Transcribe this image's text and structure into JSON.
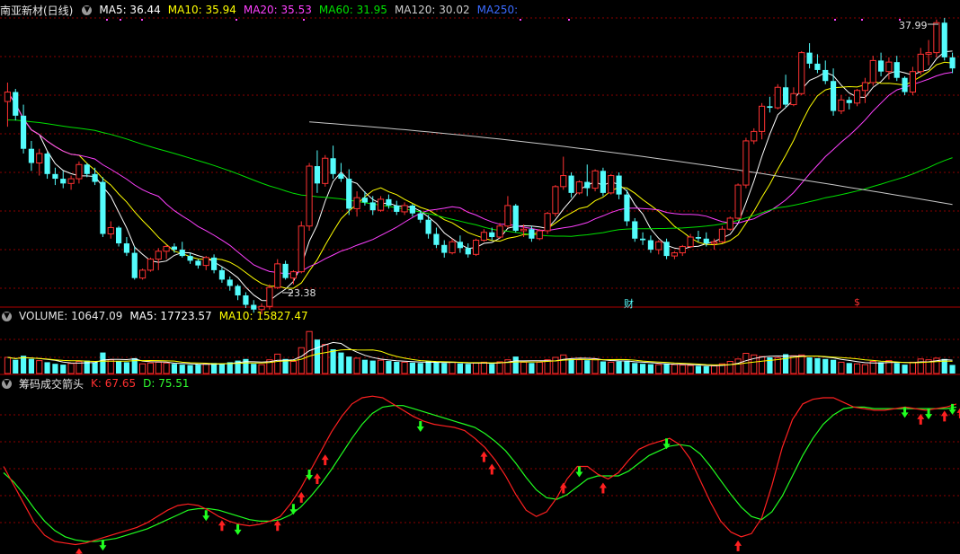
{
  "header_main": {
    "title": "南亚新材(日线)",
    "ma": [
      {
        "label": "MA5: 36.44",
        "color": "#ffffff"
      },
      {
        "label": "MA10: 35.94",
        "color": "#ffff00"
      },
      {
        "label": "MA20: 35.53",
        "color": "#ff40ff"
      },
      {
        "label": "MA60: 31.95",
        "color": "#00e000"
      },
      {
        "label": "MA120: 30.02",
        "color": "#cccccc"
      },
      {
        "label": "MA250:",
        "color": "#3b6bff"
      }
    ]
  },
  "header_volume": {
    "title": "VOLUME: 10647.09",
    "ma": [
      {
        "label": "MA5: 17723.57",
        "color": "#ffffff"
      },
      {
        "label": "MA10: 15827.47",
        "color": "#ffff00"
      }
    ]
  },
  "header_indicator": {
    "title": "筹码成交箭头",
    "k_label": "K: 67.65",
    "d_label": "D: 75.51",
    "k_color": "#ff3030",
    "d_color": "#30ff30"
  },
  "annotations": {
    "high_label": "37.99",
    "low_label": "23.38",
    "cai_tag": "财",
    "s_tag": "$"
  },
  "colors": {
    "up": "#ff3232",
    "down": "#54fcfc",
    "grid": "#8b0000",
    "ma5": "#ffffff",
    "ma10": "#ffff00",
    "ma20": "#ff40ff",
    "ma60": "#00e000",
    "ma120": "#c8c8c8",
    "k_line": "#ff2020",
    "d_line": "#20ff20"
  },
  "chart_data": {
    "type": "candlestick",
    "price_range": [
      21.5,
      39.5
    ],
    "volume_range": [
      0,
      60000
    ],
    "kd_range": [
      0,
      100
    ],
    "candles": [
      [
        34.2,
        35.4,
        32.6,
        34.8
      ],
      [
        34.8,
        35.0,
        33.0,
        33.3
      ],
      [
        33.3,
        34.0,
        30.9,
        31.2
      ],
      [
        31.2,
        31.7,
        29.8,
        30.3
      ],
      [
        30.3,
        31.2,
        29.5,
        30.9
      ],
      [
        30.9,
        31.0,
        29.3,
        29.6
      ],
      [
        29.6,
        30.0,
        28.9,
        29.3
      ],
      [
        29.3,
        29.8,
        28.7,
        29.0
      ],
      [
        29.0,
        29.5,
        28.6,
        29.3
      ],
      [
        29.3,
        30.4,
        29.0,
        30.2
      ],
      [
        30.2,
        30.3,
        29.4,
        29.6
      ],
      [
        29.6,
        30.0,
        28.9,
        29.1
      ],
      [
        29.1,
        29.4,
        25.6,
        25.8
      ],
      [
        25.8,
        26.6,
        25.5,
        26.2
      ],
      [
        26.2,
        26.3,
        25.0,
        25.2
      ],
      [
        25.2,
        25.6,
        24.4,
        24.6
      ],
      [
        24.6,
        25.0,
        22.9,
        23.0
      ],
      [
        23.0,
        23.6,
        22.9,
        23.5
      ],
      [
        23.5,
        24.3,
        23.4,
        24.2
      ],
      [
        24.2,
        24.9,
        23.5,
        24.7
      ],
      [
        24.7,
        25.1,
        24.2,
        25.0
      ],
      [
        25.0,
        25.2,
        24.6,
        24.8
      ],
      [
        24.8,
        25.3,
        24.3,
        24.4
      ],
      [
        24.4,
        24.6,
        23.9,
        24.1
      ],
      [
        24.1,
        24.2,
        23.6,
        23.8
      ],
      [
        23.8,
        24.4,
        23.5,
        24.3
      ],
      [
        24.3,
        24.5,
        23.3,
        23.5
      ],
      [
        23.5,
        23.7,
        22.7,
        22.9
      ],
      [
        22.9,
        23.1,
        22.2,
        22.5
      ],
      [
        22.5,
        22.6,
        21.6,
        21.9
      ],
      [
        21.9,
        22.1,
        21.1,
        21.3
      ],
      [
        21.3,
        21.6,
        20.8,
        21.0
      ],
      [
        21.0,
        21.4,
        20.7,
        21.2
      ],
      [
        21.2,
        22.6,
        21.0,
        22.4
      ],
      [
        22.4,
        24.2,
        22.3,
        23.9
      ],
      [
        23.9,
        24.1,
        22.9,
        23.0
      ],
      [
        23.0,
        23.5,
        22.6,
        23.4
      ],
      [
        23.4,
        26.6,
        23.3,
        26.3
      ],
      [
        26.3,
        30.3,
        26.0,
        30.1
      ],
      [
        30.1,
        31.1,
        28.4,
        29.0
      ],
      [
        29.0,
        30.8,
        28.8,
        30.6
      ],
      [
        30.6,
        31.4,
        29.3,
        29.6
      ],
      [
        29.6,
        30.3,
        29.1,
        29.3
      ],
      [
        29.3,
        29.9,
        27.0,
        27.4
      ],
      [
        27.4,
        28.5,
        26.9,
        28.1
      ],
      [
        28.1,
        28.5,
        27.6,
        27.8
      ],
      [
        27.8,
        28.2,
        27.0,
        27.3
      ],
      [
        27.3,
        28.2,
        27.2,
        28.0
      ],
      [
        28.0,
        28.3,
        27.4,
        27.6
      ],
      [
        27.6,
        27.9,
        27.0,
        27.2
      ],
      [
        27.2,
        27.8,
        27.0,
        27.6
      ],
      [
        27.6,
        27.7,
        26.9,
        27.1
      ],
      [
        27.1,
        27.3,
        26.5,
        26.7
      ],
      [
        26.7,
        27.0,
        25.5,
        25.8
      ],
      [
        25.8,
        26.2,
        24.9,
        25.1
      ],
      [
        25.1,
        25.4,
        24.3,
        24.6
      ],
      [
        24.6,
        25.5,
        24.5,
        25.3
      ],
      [
        25.3,
        25.7,
        24.6,
        24.9
      ],
      [
        24.9,
        25.2,
        24.3,
        24.5
      ],
      [
        24.5,
        25.5,
        24.4,
        25.4
      ],
      [
        25.4,
        26.1,
        25.3,
        25.9
      ],
      [
        25.9,
        26.2,
        25.4,
        25.6
      ],
      [
        25.6,
        26.5,
        25.5,
        26.3
      ],
      [
        26.3,
        28.2,
        26.2,
        27.6
      ],
      [
        27.6,
        27.7,
        25.9,
        26.0
      ],
      [
        26.0,
        26.4,
        25.6,
        26.1
      ],
      [
        26.1,
        26.3,
        25.3,
        25.5
      ],
      [
        25.5,
        26.1,
        25.4,
        26.0
      ],
      [
        26.0,
        27.2,
        25.8,
        27.1
      ],
      [
        27.1,
        28.9,
        26.9,
        28.8
      ],
      [
        28.8,
        30.7,
        28.6,
        29.5
      ],
      [
        29.5,
        29.7,
        28.1,
        28.4
      ],
      [
        28.4,
        29.2,
        28.3,
        29.1
      ],
      [
        29.1,
        30.2,
        28.2,
        28.7
      ],
      [
        28.7,
        29.9,
        28.5,
        29.8
      ],
      [
        29.8,
        30.0,
        28.2,
        28.4
      ],
      [
        28.4,
        29.6,
        28.3,
        29.5
      ],
      [
        29.5,
        29.7,
        28.0,
        28.3
      ],
      [
        28.3,
        28.6,
        26.3,
        26.6
      ],
      [
        26.6,
        26.8,
        25.3,
        25.5
      ],
      [
        25.5,
        25.9,
        25.1,
        25.4
      ],
      [
        25.4,
        25.7,
        24.6,
        24.8
      ],
      [
        24.8,
        25.4,
        24.5,
        25.3
      ],
      [
        25.3,
        25.5,
        24.2,
        24.4
      ],
      [
        24.4,
        24.7,
        24.2,
        24.6
      ],
      [
        24.6,
        25.1,
        24.4,
        25.0
      ],
      [
        25.0,
        25.8,
        24.9,
        25.6
      ],
      [
        25.6,
        26.0,
        25.3,
        25.5
      ],
      [
        25.5,
        25.9,
        25.0,
        25.2
      ],
      [
        25.2,
        25.5,
        24.8,
        25.3
      ],
      [
        25.3,
        26.3,
        25.2,
        26.1
      ],
      [
        26.1,
        26.9,
        26.0,
        26.8
      ],
      [
        26.8,
        29.0,
        26.7,
        28.9
      ],
      [
        28.9,
        31.9,
        28.7,
        31.7
      ],
      [
        31.7,
        32.5,
        31.5,
        32.3
      ],
      [
        32.3,
        34.1,
        31.8,
        33.9
      ],
      [
        33.9,
        34.5,
        33.5,
        33.8
      ],
      [
        33.8,
        35.3,
        33.7,
        35.1
      ],
      [
        35.1,
        35.9,
        33.8,
        34.0
      ],
      [
        34.0,
        35.1,
        33.9,
        34.7
      ],
      [
        34.7,
        37.4,
        34.6,
        37.3
      ],
      [
        37.3,
        37.9,
        36.3,
        36.6
      ],
      [
        36.6,
        37.2,
        36.0,
        36.2
      ],
      [
        36.2,
        36.8,
        35.3,
        35.5
      ],
      [
        35.5,
        36.3,
        33.3,
        33.6
      ],
      [
        33.6,
        34.6,
        33.4,
        34.3
      ],
      [
        34.3,
        34.5,
        33.7,
        34.1
      ],
      [
        34.1,
        35.0,
        33.9,
        34.9
      ],
      [
        34.9,
        35.7,
        34.1,
        35.4
      ],
      [
        35.4,
        37.1,
        35.2,
        36.8
      ],
      [
        36.8,
        37.3,
        35.8,
        36.1
      ],
      [
        36.1,
        37.0,
        35.6,
        36.7
      ],
      [
        36.7,
        37.1,
        35.5,
        35.7
      ],
      [
        35.7,
        35.8,
        34.6,
        34.8
      ],
      [
        34.8,
        36.4,
        34.6,
        36.1
      ],
      [
        36.1,
        37.6,
        35.9,
        37.2
      ],
      [
        37.2,
        38.1,
        36.5,
        37.3
      ],
      [
        37.3,
        39.4,
        37.0,
        39.2
      ],
      [
        39.2,
        39.5,
        36.8,
        37.0
      ],
      [
        37.0,
        37.3,
        36.0,
        36.3
      ]
    ],
    "volume": [
      20000,
      17000,
      22000,
      18000,
      16000,
      14000,
      12000,
      11000,
      12500,
      15000,
      16000,
      14000,
      26000,
      17000,
      15000,
      14000,
      19000,
      12000,
      13000,
      14000,
      13000,
      12000,
      11000,
      10500,
      11000,
      12000,
      13000,
      12500,
      14000,
      16000,
      18000,
      12000,
      11000,
      17000,
      24000,
      18000,
      15000,
      32000,
      52000,
      42000,
      36000,
      30000,
      26000,
      21000,
      19000,
      17000,
      16000,
      16500,
      15500,
      14500,
      14000,
      13500,
      13000,
      15000,
      14000,
      13000,
      14000,
      12500,
      12000,
      13000,
      14000,
      12000,
      14500,
      17000,
      21000,
      14000,
      13000,
      14000,
      17000,
      20000,
      23000,
      18000,
      17000,
      16500,
      18000,
      15000,
      14000,
      15000,
      16000,
      13000,
      12000,
      11500,
      11000,
      12500,
      11000,
      10500,
      10000,
      9500,
      9000,
      9500,
      12000,
      15000,
      18000,
      25000,
      23000,
      21000,
      20000,
      19500,
      24000,
      22000,
      23000,
      20000,
      19000,
      18000,
      17000,
      14000,
      13000,
      12000,
      11000,
      15000,
      14000,
      16000,
      13000,
      11000,
      14000,
      18000,
      17000,
      19000,
      18000,
      10647
    ],
    "k": [
      52,
      40,
      28,
      16,
      8,
      4,
      3,
      2,
      3,
      5,
      7,
      9,
      11,
      13,
      16,
      20,
      24,
      27,
      28,
      27,
      24,
      20,
      17,
      15,
      14,
      15,
      17,
      20,
      28,
      38,
      50,
      62,
      74,
      84,
      92,
      96,
      97,
      96,
      92,
      88,
      84,
      81,
      79,
      78,
      77,
      75,
      70,
      64,
      56,
      46,
      34,
      24,
      20,
      23,
      32,
      44,
      52,
      52,
      47,
      44,
      48,
      56,
      63,
      66,
      68,
      70,
      66,
      57,
      43,
      29,
      17,
      10,
      7,
      9,
      19,
      40,
      64,
      82,
      92,
      95,
      96,
      96,
      93,
      90,
      89,
      88,
      88,
      89,
      90,
      89,
      88,
      89,
      90,
      92
    ],
    "d": [
      48,
      42,
      34,
      25,
      17,
      11,
      7,
      5,
      4,
      4,
      5,
      6,
      8,
      10,
      12,
      15,
      18,
      21,
      24,
      25,
      25,
      24,
      22,
      20,
      18,
      17,
      17,
      18,
      21,
      26,
      33,
      41,
      50,
      60,
      70,
      79,
      86,
      90,
      91,
      91,
      89,
      87,
      85,
      83,
      81,
      79,
      77,
      73,
      68,
      62,
      54,
      45,
      37,
      32,
      31,
      34,
      39,
      44,
      46,
      46,
      46,
      49,
      54,
      59,
      62,
      65,
      66,
      65,
      60,
      52,
      43,
      34,
      26,
      20,
      18,
      23,
      33,
      46,
      59,
      70,
      79,
      85,
      89,
      90,
      90,
      89,
      89,
      89,
      89,
      89,
      89,
      89,
      89,
      90
    ],
    "markers": [
      {
        "i": 9,
        "dir": "up"
      },
      {
        "i": 12,
        "dir": "down"
      },
      {
        "i": 25,
        "dir": "down"
      },
      {
        "i": 27,
        "dir": "up"
      },
      {
        "i": 29,
        "dir": "down"
      },
      {
        "i": 34,
        "dir": "up"
      },
      {
        "i": 36,
        "dir": "down"
      },
      {
        "i": 37,
        "dir": "up"
      },
      {
        "i": 38,
        "dir": "down"
      },
      {
        "i": 39,
        "dir": "up"
      },
      {
        "i": 40,
        "dir": "up"
      },
      {
        "i": 52,
        "dir": "down"
      },
      {
        "i": 60,
        "dir": "up"
      },
      {
        "i": 61,
        "dir": "up"
      },
      {
        "i": 70,
        "dir": "up"
      },
      {
        "i": 72,
        "dir": "down"
      },
      {
        "i": 75,
        "dir": "up"
      },
      {
        "i": 83,
        "dir": "down"
      },
      {
        "i": 92,
        "dir": "up"
      },
      {
        "i": 113,
        "dir": "down"
      },
      {
        "i": 115,
        "dir": "up"
      },
      {
        "i": 116,
        "dir": "down"
      },
      {
        "i": 118,
        "dir": "up"
      },
      {
        "i": 119,
        "dir": "down"
      },
      {
        "i": 120,
        "dir": "up"
      },
      {
        "i": 122,
        "dir": "down"
      },
      {
        "i": 124,
        "dir": "down"
      },
      {
        "i": 125,
        "dir": "up"
      },
      {
        "i": 126,
        "dir": "down"
      },
      {
        "i": 127,
        "dir": "down"
      }
    ]
  }
}
